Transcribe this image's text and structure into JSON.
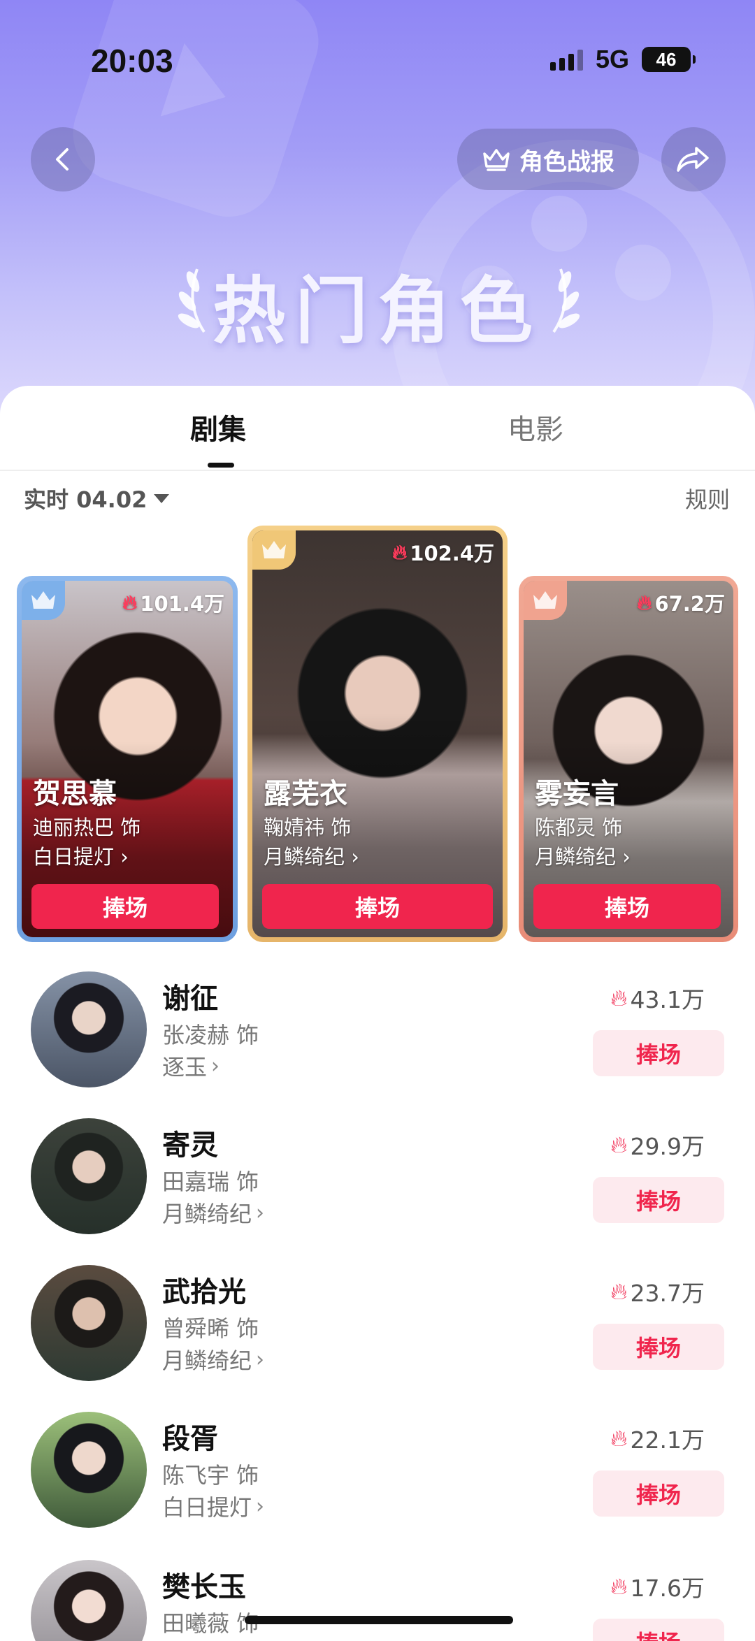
{
  "status_bar": {
    "time": "20:03",
    "network": "5G",
    "battery": "46"
  },
  "header": {
    "report_label": "角色战报",
    "title": "热门角色"
  },
  "tabs": [
    {
      "label": "剧集",
      "active": true
    },
    {
      "label": "电影",
      "active": false
    }
  ],
  "filter": {
    "label": "实时 04.02",
    "rules_label": "规则"
  },
  "cheer_label": "捧场",
  "top3": [
    {
      "rank": 2,
      "heat": "101.4万",
      "name": "贺思慕",
      "actor": "迪丽热巴 饰",
      "show": "白日提灯",
      "badge_color": "#7db0ea"
    },
    {
      "rank": 1,
      "heat": "102.4万",
      "name": "露芜衣",
      "actor": "鞠婧祎 饰",
      "show": "月鳞绮纪",
      "badge_color": "#f0c777"
    },
    {
      "rank": 3,
      "heat": "67.2万",
      "name": "雾妄言",
      "actor": "陈都灵 饰",
      "show": "月鳞绮纪",
      "badge_color": "#f0a38f"
    }
  ],
  "list": [
    {
      "name": "谢征",
      "actor": "张凌赫 饰",
      "show": "逐玉",
      "heat": "43.1万"
    },
    {
      "name": "寄灵",
      "actor": "田嘉瑞 饰",
      "show": "月鳞绮纪",
      "heat": "29.9万"
    },
    {
      "name": "武拾光",
      "actor": "曾舜晞 饰",
      "show": "月鳞绮纪",
      "heat": "23.7万"
    },
    {
      "name": "段胥",
      "actor": "陈飞宇 饰",
      "show": "白日提灯",
      "heat": "22.1万"
    },
    {
      "name": "樊长玉",
      "actor": "田曦薇 饰",
      "show": "",
      "heat": "17.6万"
    }
  ],
  "colors": {
    "accent": "#f0254d",
    "accent_soft": "#fdeaee",
    "hero_top": "#8f86f5"
  }
}
